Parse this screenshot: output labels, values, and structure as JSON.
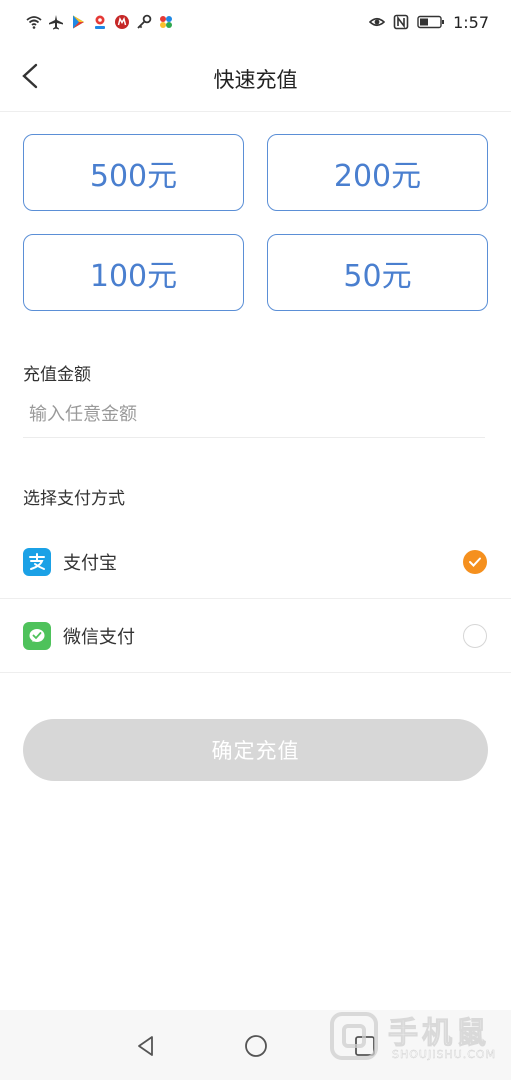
{
  "status_bar": {
    "time": "1:57",
    "left_icons": [
      "wifi-icon",
      "airplane-icon",
      "play-store-icon",
      "map-pin-icon",
      "app-badge-icon",
      "key-icon",
      "pinwheel-icon"
    ],
    "right_icons": [
      "eye-icon",
      "nfc-icon",
      "battery-icon"
    ]
  },
  "header": {
    "title": "快速充值"
  },
  "amount_options": [
    {
      "label": "500元"
    },
    {
      "label": "200元"
    },
    {
      "label": "100元"
    },
    {
      "label": "50元"
    }
  ],
  "amount_section": {
    "label": "充值金额",
    "placeholder": "输入任意金额",
    "value": ""
  },
  "payment_section": {
    "label": "选择支付方式",
    "methods": [
      {
        "name": "支付宝",
        "icon": "alipay-icon",
        "selected": true
      },
      {
        "name": "微信支付",
        "icon": "wechat-pay-icon",
        "selected": false
      }
    ]
  },
  "confirm_button": {
    "label": "确定充值"
  },
  "colors": {
    "accent_blue": "#4a7fcf",
    "selected_orange": "#f5901e",
    "disabled_button": "#d7d7d7",
    "alipay": "#1ba1e6",
    "wechat": "#4ec25b"
  },
  "watermark": {
    "text_cn": "手机鼠",
    "text_en": "SHOUJISHU.COM"
  }
}
